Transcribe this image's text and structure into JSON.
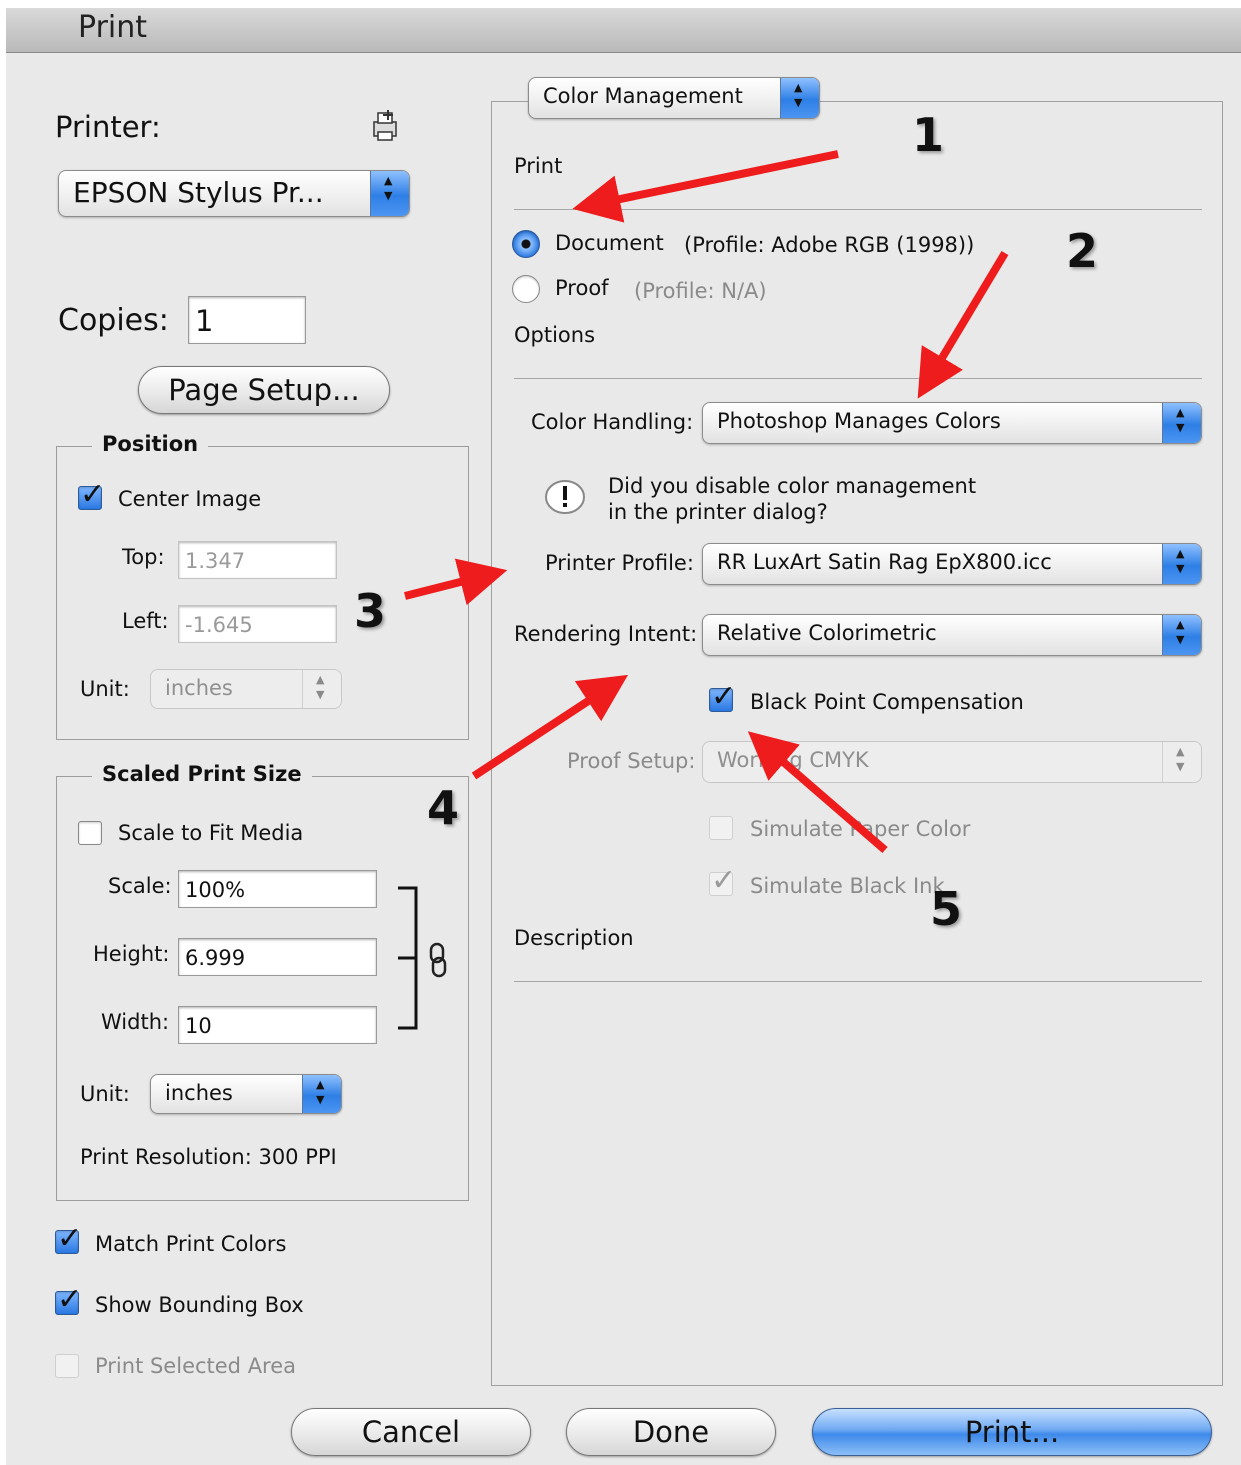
{
  "window": {
    "title": "Print"
  },
  "printer": {
    "label": "Printer:",
    "selected": "EPSON Stylus Pr...",
    "icon": "printer-icon"
  },
  "copies": {
    "label": "Copies:",
    "value": "1"
  },
  "page_setup_label": "Page Setup...",
  "position": {
    "title": "Position",
    "center_image_label": "Center Image",
    "center_image_checked": true,
    "top_label": "Top:",
    "top_value": "1.347",
    "left_label": "Left:",
    "left_value": "-1.645",
    "unit_label": "Unit:",
    "unit_value": "inches"
  },
  "scaled": {
    "title": "Scaled Print Size",
    "scale_fit_label": "Scale to Fit Media",
    "scale_fit_checked": false,
    "scale_label": "Scale:",
    "scale_value": "100%",
    "height_label": "Height:",
    "height_value": "6.999",
    "width_label": "Width:",
    "width_value": "10",
    "unit_label": "Unit:",
    "unit_value": "inches",
    "resolution": "Print Resolution: 300 PPI",
    "link_icon": "chain-link-icon"
  },
  "options_left": {
    "match_colors": "Match Print Colors",
    "show_bbox": "Show Bounding Box",
    "print_selected": "Print Selected Area"
  },
  "right": {
    "section_popup": "Color Management",
    "print_heading": "Print",
    "document_label": "Document",
    "document_profile": "(Profile: Adobe RGB (1998))",
    "proof_label": "Proof",
    "proof_profile": "(Profile: N/A)",
    "options_heading": "Options",
    "color_handling_label": "Color Handling:",
    "color_handling_value": "Photoshop Manages Colors",
    "warning_line1": "Did you disable color management",
    "warning_line2": "in the printer dialog?",
    "warning_icon": "exclamation-icon",
    "printer_profile_label": "Printer Profile:",
    "printer_profile_value": "RR LuxArt Satin Rag EpX800.icc",
    "rendering_intent_label": "Rendering Intent:",
    "rendering_intent_value": "Relative Colorimetric",
    "bpc_label": "Black Point Compensation",
    "proof_setup_label": "Proof Setup:",
    "proof_setup_value": "Working CMYK",
    "simulate_paper": "Simulate Paper Color",
    "simulate_ink": "Simulate Black Ink",
    "description_heading": "Description"
  },
  "buttons": {
    "cancel": "Cancel",
    "done": "Done",
    "print": "Print..."
  },
  "annotations": {
    "n1": "1",
    "n2": "2",
    "n3": "3",
    "n4": "4",
    "n5": "5",
    "arrow_color": "#ee1c1c"
  },
  "colors": {
    "dialog_bg": "#e9e9e9",
    "accent": "#2e7fe6"
  }
}
